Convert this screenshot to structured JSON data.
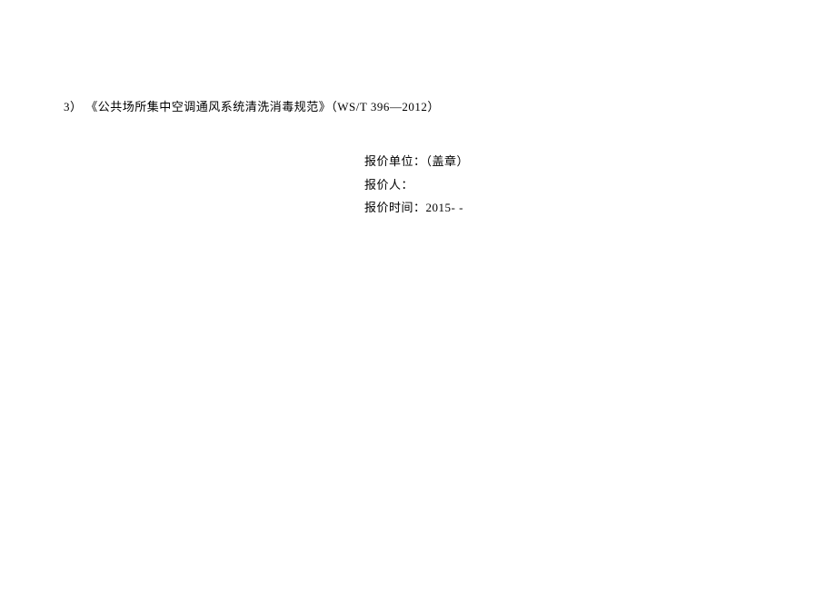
{
  "list": {
    "item_3": "3） 《公共场所集中空调通风系统清洗消毒规范》（WS/T 396—2012）"
  },
  "signature": {
    "unit_label": "报价单位：（盖章）",
    "person_label": "报价人：",
    "date_label": "报价时间：2015-    -"
  }
}
